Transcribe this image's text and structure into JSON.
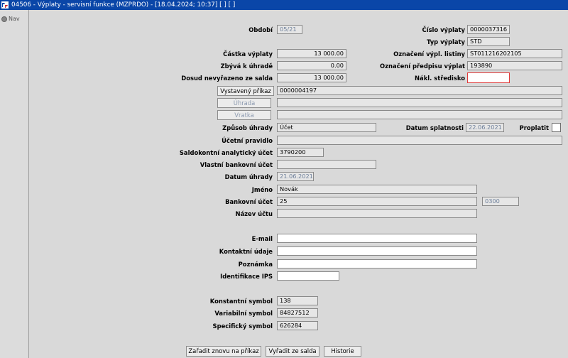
{
  "window": {
    "title": "04506 - Výplaty - servisní funkce (MZPRDO) - [18.04.2024; 10:37] [ ] [ ]"
  },
  "nav": {
    "label": "Nav"
  },
  "labels": {
    "obdobi": "Období",
    "cislo_vyplaty": "Číslo výplaty",
    "typ_vyplaty": "Typ výplaty",
    "castka_vyplaty": "Částka výplaty",
    "oznaceni_vypl_listiny": "Označení výpl. listiny",
    "zbyva_k_uhrade": "Zbývá k úhradě",
    "oznaceni_predpisu": "Označení předpisu výplat",
    "dosud_nevyrazeno": "Dosud nevyřazeno ze salda",
    "nakl_stredisko": "Nákl. středisko",
    "zpusob_uhrady": "Způsob úhrady",
    "datum_splatnosti": "Datum splatnosti",
    "proplatit": "Proplatit",
    "ucetni_pravidlo": "Účetní pravidlo",
    "saldokontni_ucet": "Saldokontní analytický účet",
    "vlastni_bankovni_ucet": "Vlastní bankovní účet",
    "datum_uhrady": "Datum úhrady",
    "jmeno": "Jméno",
    "bankovni_ucet": "Bankovní účet",
    "nazev_uctu": "Název účtu",
    "email": "E-mail",
    "kontaktni_udaje": "Kontaktní údaje",
    "poznamka": "Poznámka",
    "identifikace_ips": "Identifikace IPS",
    "konstantni_symbol": "Konstantní symbol",
    "variabilni_symbol": "Variabilní symbol",
    "specificky_symbol": "Specifický symbol"
  },
  "values": {
    "obdobi": "05/21",
    "cislo_vyplaty": "0000037316",
    "typ_vyplaty": "STD",
    "castka_vyplaty": "13 000.00",
    "oznaceni_vypl_listiny": "ST011216202105",
    "zbyva_k_uhrade": "0.00",
    "oznaceni_predpisu": "193890",
    "dosud_nevyrazeno": "13 000.00",
    "nakl_stredisko": "",
    "vystaveny_prikaz": "0000004197",
    "uhrada": "",
    "vratka": "",
    "zpusob_uhrady": "Účet",
    "datum_splatnosti": "22.06.2021",
    "ucetni_pravidlo": "",
    "saldokontni_ucet": "3790200",
    "vlastni_bankovni_ucet": "",
    "datum_uhrady": "21.06.2021",
    "jmeno": "Novák",
    "bankovni_ucet": "25",
    "kod_banky": "0300",
    "nazev_uctu": "",
    "email": "",
    "kontaktni_udaje": "",
    "poznamka": "",
    "identifikace_ips": "",
    "konstantni_symbol": "138",
    "variabilni_symbol": "84827512",
    "specificky_symbol": "626284"
  },
  "buttons": {
    "vystaveny_prikaz": "Vystavený příkaz",
    "uhrada": "Úhrada",
    "vratka": "Vratka",
    "zaradit_znovu": "Zařadit znovu na příkaz",
    "vyradit_ze_salda": "Vyřadit ze salda",
    "historie": "Historie"
  },
  "colors": {
    "titlebar": "#0a46a8",
    "required_border": "#e03a3a",
    "background": "#d9d9d9"
  }
}
